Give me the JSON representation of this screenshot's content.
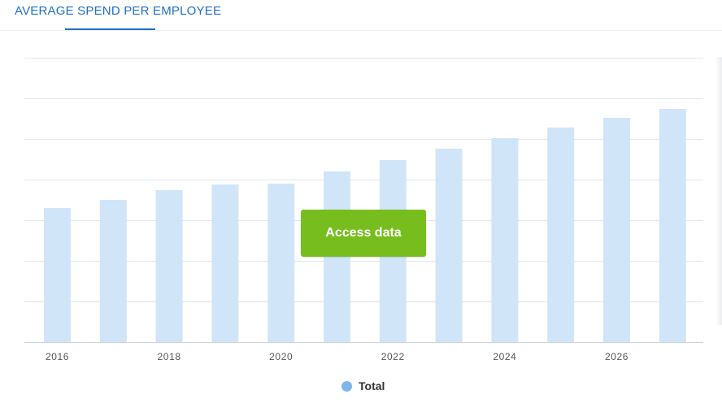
{
  "header": {
    "title": "AVERAGE SPEND PER EMPLOYEE"
  },
  "cta": {
    "label": "Access data"
  },
  "colors": {
    "accent": "#1f6fc4",
    "bar": "#d1e5f9",
    "legend_marker": "#7db7ea",
    "button": "#77bd1e",
    "grid": "#e3e6ea",
    "axis": "#ccd3db"
  },
  "chart_data": {
    "type": "bar",
    "categories": [
      "2016",
      "2017",
      "2018",
      "2019",
      "2020",
      "2021",
      "2022",
      "2023",
      "2024",
      "2025",
      "2026",
      "2027"
    ],
    "tick_labels": [
      "2016",
      "2018",
      "2020",
      "2022",
      "2024",
      "2026"
    ],
    "series": [
      {
        "name": "Total",
        "values": [
          33,
          35,
          37.4,
          38.8,
          39,
          42,
          44.8,
          47.6,
          50.2,
          52.8,
          55.2,
          57.4
        ]
      }
    ],
    "ylim": [
      0,
      70
    ],
    "grid": true,
    "legend": "bottom-center",
    "title": "",
    "xlabel": "",
    "ylabel": ""
  }
}
